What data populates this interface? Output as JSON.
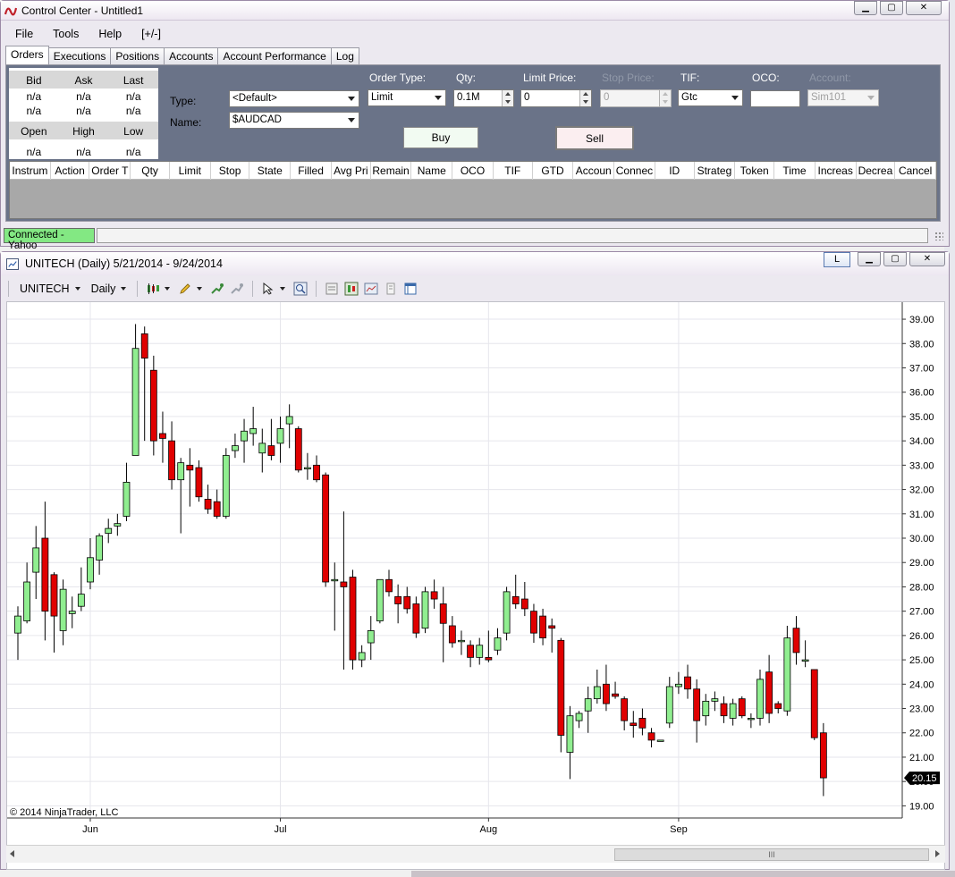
{
  "control_center": {
    "title": "Control Center - Untitled1",
    "menu": [
      "File",
      "Tools",
      "Help",
      "[+/-]"
    ],
    "tabs": [
      "Orders",
      "Executions",
      "Positions",
      "Accounts",
      "Account Performance",
      "Log"
    ],
    "active_tab": "Orders",
    "quote": {
      "row1_headers": [
        "Bid",
        "Ask",
        "Last"
      ],
      "row1_values_a": [
        "n/a",
        "n/a",
        "n/a"
      ],
      "row1_values_b": [
        "n/a",
        "n/a",
        "n/a"
      ],
      "row2_headers": [
        "Open",
        "High",
        "Low"
      ],
      "row2_values": [
        "n/a",
        "n/a",
        "n/a"
      ]
    },
    "order_entry": {
      "type_label": "Type:",
      "type_value": "<Default>",
      "name_label": "Name:",
      "name_value": "$AUDCAD",
      "order_type_label": "Order Type:",
      "order_type_value": "Limit",
      "qty_label": "Qty:",
      "qty_value": "0.1M",
      "limit_price_label": "Limit Price:",
      "limit_price_value": "0",
      "stop_price_label": "Stop Price:",
      "stop_price_value": "0",
      "tif_label": "TIF:",
      "tif_value": "Gtc",
      "oco_label": "OCO:",
      "oco_value": "",
      "account_label": "Account:",
      "account_value": "Sim101",
      "buy_label": "Buy",
      "sell_label": "Sell"
    },
    "orders_columns": [
      "Instrum",
      "Action",
      "Order T",
      "Qty",
      "Limit",
      "Stop",
      "State",
      "Filled",
      "Avg Pri",
      "Remain",
      "Name",
      "OCO",
      "TIF",
      "GTD",
      "Accoun",
      "Connec",
      "ID",
      "Strateg",
      "Token",
      "Time",
      "Increas",
      "Decrea",
      "Cancel"
    ],
    "status": "Connected - Yahoo",
    "colors": {
      "status_connected": "#83e883",
      "panel_bg": "#6a7388",
      "accent_logo": "#c0202a"
    }
  },
  "chart_window": {
    "title": "UNITECH (Daily)  5/21/2014 - 9/24/2014",
    "l_button": "L",
    "instrument": "UNITECH",
    "period": "Daily",
    "copyright": "© 2014 NinjaTrader, LLC",
    "last_price_label": "20.15",
    "scroll_thumb_label": "III",
    "toolbar_icons": [
      "bar-style-icon",
      "drawing-pencil-icon",
      "indicator-icon",
      "strategy-icon",
      "cursor-icon",
      "zoom-icon",
      "data-box-icon",
      "chart-trader-icon",
      "chart-properties-icon",
      "print-icon",
      "window-linking-icon"
    ]
  },
  "chart_data": {
    "type": "candlestick",
    "title": "UNITECH (Daily)",
    "ylim": [
      18.5,
      39.7
    ],
    "y_ticks": [
      19,
      20,
      21,
      22,
      23,
      24,
      25,
      26,
      27,
      28,
      29,
      30,
      31,
      32,
      33,
      34,
      35,
      36,
      37,
      38,
      39
    ],
    "y_tick_labels": [
      "19.00",
      "20.00",
      "21.00",
      "22.00",
      "23.00",
      "24.00",
      "25.00",
      "26.00",
      "27.00",
      "28.00",
      "29.00",
      "30.00",
      "31.00",
      "32.00",
      "33.00",
      "34.00",
      "35.00",
      "36.00",
      "37.00",
      "38.00",
      "39.00"
    ],
    "x_ticks": [
      {
        "label": "Jun",
        "bar": 8
      },
      {
        "label": "Jul",
        "bar": 29
      },
      {
        "label": "Aug",
        "bar": 52
      },
      {
        "label": "Sep",
        "bar": 73
      }
    ],
    "last_price": 20.15,
    "colors": {
      "up": "#90ee90",
      "down": "#e00000",
      "wick": "#000000",
      "grid": "#e6e6ec"
    },
    "candles": [
      {
        "o": 26.1,
        "h": 27.2,
        "l": 25.0,
        "c": 26.8
      },
      {
        "o": 26.6,
        "h": 29.0,
        "l": 26.5,
        "c": 28.2
      },
      {
        "o": 28.6,
        "h": 30.5,
        "l": 27.5,
        "c": 29.6
      },
      {
        "o": 30.0,
        "h": 31.5,
        "l": 25.8,
        "c": 27.0
      },
      {
        "o": 28.5,
        "h": 28.6,
        "l": 25.3,
        "c": 26.8
      },
      {
        "o": 26.2,
        "h": 28.3,
        "l": 25.6,
        "c": 27.9
      },
      {
        "o": 26.9,
        "h": 27.6,
        "l": 26.3,
        "c": 27.0
      },
      {
        "o": 27.2,
        "h": 28.8,
        "l": 27.0,
        "c": 27.7
      },
      {
        "o": 28.2,
        "h": 30.0,
        "l": 27.9,
        "c": 29.2
      },
      {
        "o": 29.1,
        "h": 30.2,
        "l": 28.5,
        "c": 30.1
      },
      {
        "o": 30.2,
        "h": 30.8,
        "l": 29.8,
        "c": 30.4
      },
      {
        "o": 30.5,
        "h": 31.0,
        "l": 30.1,
        "c": 30.6
      },
      {
        "o": 30.9,
        "h": 33.1,
        "l": 30.7,
        "c": 32.3
      },
      {
        "o": 33.4,
        "h": 38.8,
        "l": 33.4,
        "c": 37.8
      },
      {
        "o": 38.4,
        "h": 38.7,
        "l": 34.0,
        "c": 37.4
      },
      {
        "o": 36.9,
        "h": 37.5,
        "l": 33.4,
        "c": 34.0
      },
      {
        "o": 34.3,
        "h": 35.2,
        "l": 33.1,
        "c": 34.1
      },
      {
        "o": 34.0,
        "h": 34.8,
        "l": 32.0,
        "c": 32.4
      },
      {
        "o": 32.4,
        "h": 33.3,
        "l": 30.2,
        "c": 33.1
      },
      {
        "o": 33.0,
        "h": 33.7,
        "l": 31.3,
        "c": 32.8
      },
      {
        "o": 32.9,
        "h": 33.2,
        "l": 31.5,
        "c": 31.7
      },
      {
        "o": 31.6,
        "h": 32.2,
        "l": 31.0,
        "c": 31.2
      },
      {
        "o": 31.5,
        "h": 32.0,
        "l": 30.8,
        "c": 30.9
      },
      {
        "o": 30.9,
        "h": 33.7,
        "l": 30.8,
        "c": 33.4
      },
      {
        "o": 33.6,
        "h": 34.3,
        "l": 33.3,
        "c": 33.8
      },
      {
        "o": 34.0,
        "h": 34.9,
        "l": 33.1,
        "c": 34.4
      },
      {
        "o": 34.3,
        "h": 35.4,
        "l": 33.8,
        "c": 34.5
      },
      {
        "o": 33.5,
        "h": 34.5,
        "l": 32.7,
        "c": 33.9
      },
      {
        "o": 33.8,
        "h": 34.9,
        "l": 33.2,
        "c": 33.4
      },
      {
        "o": 33.9,
        "h": 35.0,
        "l": 33.1,
        "c": 34.5
      },
      {
        "o": 34.7,
        "h": 35.5,
        "l": 33.7,
        "c": 35.0
      },
      {
        "o": 34.5,
        "h": 34.6,
        "l": 32.7,
        "c": 32.8
      },
      {
        "o": 32.9,
        "h": 33.5,
        "l": 32.4,
        "c": 32.9
      },
      {
        "o": 33.0,
        "h": 33.4,
        "l": 32.3,
        "c": 32.4
      },
      {
        "o": 32.6,
        "h": 32.7,
        "l": 28.0,
        "c": 28.2
      },
      {
        "o": 28.3,
        "h": 29.0,
        "l": 26.2,
        "c": 28.3
      },
      {
        "o": 28.2,
        "h": 31.1,
        "l": 24.6,
        "c": 28.0
      },
      {
        "o": 28.4,
        "h": 28.7,
        "l": 24.6,
        "c": 25.0
      },
      {
        "o": 25.0,
        "h": 25.6,
        "l": 24.7,
        "c": 25.3
      },
      {
        "o": 25.7,
        "h": 26.8,
        "l": 25.0,
        "c": 26.2
      },
      {
        "o": 26.6,
        "h": 28.3,
        "l": 26.5,
        "c": 28.3
      },
      {
        "o": 28.3,
        "h": 28.7,
        "l": 27.6,
        "c": 27.8
      },
      {
        "o": 27.6,
        "h": 28.1,
        "l": 26.5,
        "c": 27.3
      },
      {
        "o": 27.6,
        "h": 28.0,
        "l": 26.9,
        "c": 27.1
      },
      {
        "o": 27.3,
        "h": 27.6,
        "l": 25.9,
        "c": 26.1
      },
      {
        "o": 26.3,
        "h": 28.0,
        "l": 26.1,
        "c": 27.8
      },
      {
        "o": 27.8,
        "h": 28.3,
        "l": 27.1,
        "c": 27.5
      },
      {
        "o": 27.3,
        "h": 28.0,
        "l": 24.9,
        "c": 26.5
      },
      {
        "o": 26.4,
        "h": 26.8,
        "l": 25.5,
        "c": 25.7
      },
      {
        "o": 25.8,
        "h": 26.2,
        "l": 25.2,
        "c": 25.8
      },
      {
        "o": 25.6,
        "h": 25.8,
        "l": 24.7,
        "c": 25.1
      },
      {
        "o": 25.1,
        "h": 25.9,
        "l": 24.8,
        "c": 25.6
      },
      {
        "o": 25.1,
        "h": 26.2,
        "l": 24.9,
        "c": 25.0
      },
      {
        "o": 25.4,
        "h": 26.3,
        "l": 25.2,
        "c": 25.9
      },
      {
        "o": 26.1,
        "h": 28.0,
        "l": 25.8,
        "c": 27.8
      },
      {
        "o": 27.6,
        "h": 28.5,
        "l": 27.1,
        "c": 27.3
      },
      {
        "o": 27.5,
        "h": 28.2,
        "l": 26.8,
        "c": 27.1
      },
      {
        "o": 27.0,
        "h": 27.3,
        "l": 25.7,
        "c": 26.1
      },
      {
        "o": 26.8,
        "h": 27.1,
        "l": 25.6,
        "c": 25.9
      },
      {
        "o": 26.4,
        "h": 26.7,
        "l": 25.3,
        "c": 26.3
      },
      {
        "o": 25.8,
        "h": 25.9,
        "l": 21.2,
        "c": 21.9
      },
      {
        "o": 21.2,
        "h": 23.1,
        "l": 20.1,
        "c": 22.7
      },
      {
        "o": 22.5,
        "h": 22.9,
        "l": 22.2,
        "c": 22.8
      },
      {
        "o": 22.9,
        "h": 23.9,
        "l": 22.0,
        "c": 23.4
      },
      {
        "o": 23.4,
        "h": 24.6,
        "l": 23.2,
        "c": 23.9
      },
      {
        "o": 24.0,
        "h": 24.8,
        "l": 22.9,
        "c": 23.2
      },
      {
        "o": 23.6,
        "h": 24.1,
        "l": 23.4,
        "c": 23.5
      },
      {
        "o": 23.4,
        "h": 23.5,
        "l": 22.1,
        "c": 22.5
      },
      {
        "o": 22.4,
        "h": 22.9,
        "l": 21.8,
        "c": 22.3
      },
      {
        "o": 22.6,
        "h": 23.0,
        "l": 21.9,
        "c": 22.2
      },
      {
        "o": 22.0,
        "h": 22.2,
        "l": 21.4,
        "c": 21.7
      },
      {
        "o": 21.7,
        "h": 21.7,
        "l": 21.7,
        "c": 21.7
      },
      {
        "o": 22.4,
        "h": 24.3,
        "l": 22.2,
        "c": 23.9
      },
      {
        "o": 23.9,
        "h": 24.5,
        "l": 23.6,
        "c": 24.0
      },
      {
        "o": 24.3,
        "h": 24.8,
        "l": 23.4,
        "c": 23.8
      },
      {
        "o": 23.8,
        "h": 24.2,
        "l": 21.6,
        "c": 22.5
      },
      {
        "o": 22.7,
        "h": 23.6,
        "l": 22.3,
        "c": 23.3
      },
      {
        "o": 23.3,
        "h": 23.7,
        "l": 22.9,
        "c": 23.4
      },
      {
        "o": 23.2,
        "h": 23.5,
        "l": 22.4,
        "c": 22.7
      },
      {
        "o": 22.6,
        "h": 23.4,
        "l": 22.3,
        "c": 23.2
      },
      {
        "o": 23.4,
        "h": 23.5,
        "l": 22.6,
        "c": 22.7
      },
      {
        "o": 22.6,
        "h": 22.8,
        "l": 22.2,
        "c": 22.6
      },
      {
        "o": 22.6,
        "h": 24.6,
        "l": 22.3,
        "c": 24.2
      },
      {
        "o": 24.5,
        "h": 25.2,
        "l": 22.4,
        "c": 22.8
      },
      {
        "o": 23.2,
        "h": 23.3,
        "l": 22.8,
        "c": 23.0
      },
      {
        "o": 22.9,
        "h": 26.4,
        "l": 22.7,
        "c": 25.9
      },
      {
        "o": 26.3,
        "h": 26.8,
        "l": 24.8,
        "c": 25.3
      },
      {
        "o": 25.0,
        "h": 25.8,
        "l": 24.7,
        "c": 25.0
      },
      {
        "o": 24.6,
        "h": 24.6,
        "l": 21.7,
        "c": 21.8
      },
      {
        "o": 22.0,
        "h": 22.4,
        "l": 19.4,
        "c": 20.15
      }
    ]
  }
}
